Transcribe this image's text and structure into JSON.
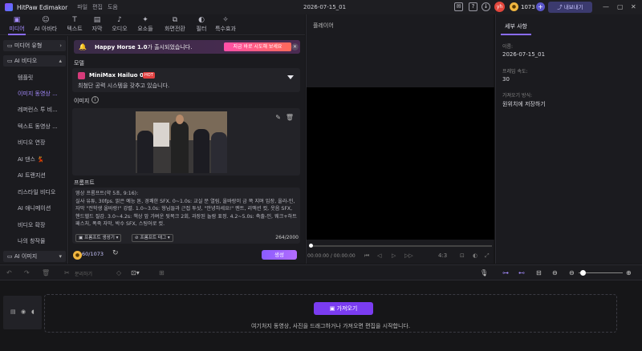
{
  "titlebar": {
    "app_name": "HitPaw Edimakor",
    "menu": [
      "파일",
      "편집",
      "도움"
    ],
    "project_name": "2026-07-15_01",
    "avatar": "yh",
    "credits": "1073",
    "export_label": "내보내기"
  },
  "toolbar": {
    "tools": [
      {
        "label": "미디어",
        "icon": "media-icon",
        "glyph": "▣"
      },
      {
        "label": "AI 아바타",
        "icon": "avatar-icon",
        "glyph": "☺"
      },
      {
        "label": "텍스트",
        "icon": "text-icon",
        "glyph": "T"
      },
      {
        "label": "자막",
        "icon": "subtitle-icon",
        "glyph": "▤"
      },
      {
        "label": "오디오",
        "icon": "audio-icon",
        "glyph": "♪"
      },
      {
        "label": "요소들",
        "icon": "elements-icon",
        "glyph": "✦"
      },
      {
        "label": "화면전환",
        "icon": "transition-icon",
        "glyph": "⧉"
      },
      {
        "label": "필터",
        "icon": "filter-icon",
        "glyph": "◐"
      },
      {
        "label": "특수효과",
        "icon": "effects-icon",
        "glyph": "✧"
      }
    ]
  },
  "sidebar": {
    "group1": "미디어 유형",
    "group2": "AI 비디오",
    "items": [
      "템플릿",
      "이미지 동영상 ...",
      "레퍼런스 투 비...",
      "텍스트 동영상 ...",
      "비디오 연장",
      "AI 댄스 💃",
      "AI 트랜지션",
      "리스타일 비디오",
      "AI 애니메이션",
      "비디오 확장",
      "나의 창작물"
    ],
    "group3": "AI 이미지"
  },
  "panel": {
    "banner": {
      "title": "Happy Horse 1.0",
      "text": "가 출시되었습니다.",
      "button": "지금 바로 시도해 보세요"
    },
    "model_label": "모델",
    "model_name": "MiniMax Hailuo 02",
    "model_badge": "HOT",
    "model_desc": "최첨단 공력 시스템을 갖추고 있습니다.",
    "image_label": "이미지",
    "prompt_label": "프롬프트",
    "prompt_text": "영상 프롬프트(약 5초, 9:16):\n실사 유튜, 30fps. 밝은 예능 톤, 경쾌한 SFX. 0~1.0s: 교실 문 열림, 올바랑이 금 쪽 지며 입장, 올라-인, 자막 \"전학생 올바랑!\" 강렬. 1.0~3.0s: 형님들과 근접 투샷, \"안녕하세요!\" 멘트, 리액션 컷, 웃음 SFX, 핸드헬드 질감. 3.0~4.2s: 책상 앞 가벼운 뒷목크 2회, 과장된 놀람 표정. 4.2~5.0s: 축출-인, 웨크+하트 패스처, 폭죽 자막, 박수 SFX, 스팅어로 컷.",
    "btn_generator": "프롬프트 생성기",
    "btn_tags": "프롬프트 태그",
    "char_count": "264/2000",
    "cost": "60/1073",
    "generate": "생성"
  },
  "player": {
    "title": "플레이어",
    "time": "00:00:00 / 00:00:00",
    "ratio": "4:3"
  },
  "details": {
    "tab": "세부 사항",
    "fields": [
      {
        "key": "이름:",
        "value": "2026-07-15_01"
      },
      {
        "key": "프레임 속도:",
        "value": "30"
      },
      {
        "key": "가져오기 방식:",
        "value": "원위치에 저장하기"
      }
    ]
  },
  "timeline": {
    "split_label": "분리하기",
    "import_label": "가져오기",
    "drop_text": "여기처지 동영상, 사진을 드래그하거나 가져오면 편집을 시작합니다."
  },
  "colors": {
    "accent": "#8a6cff",
    "generate": "#9a5cff",
    "import": "#7a3cf0"
  }
}
